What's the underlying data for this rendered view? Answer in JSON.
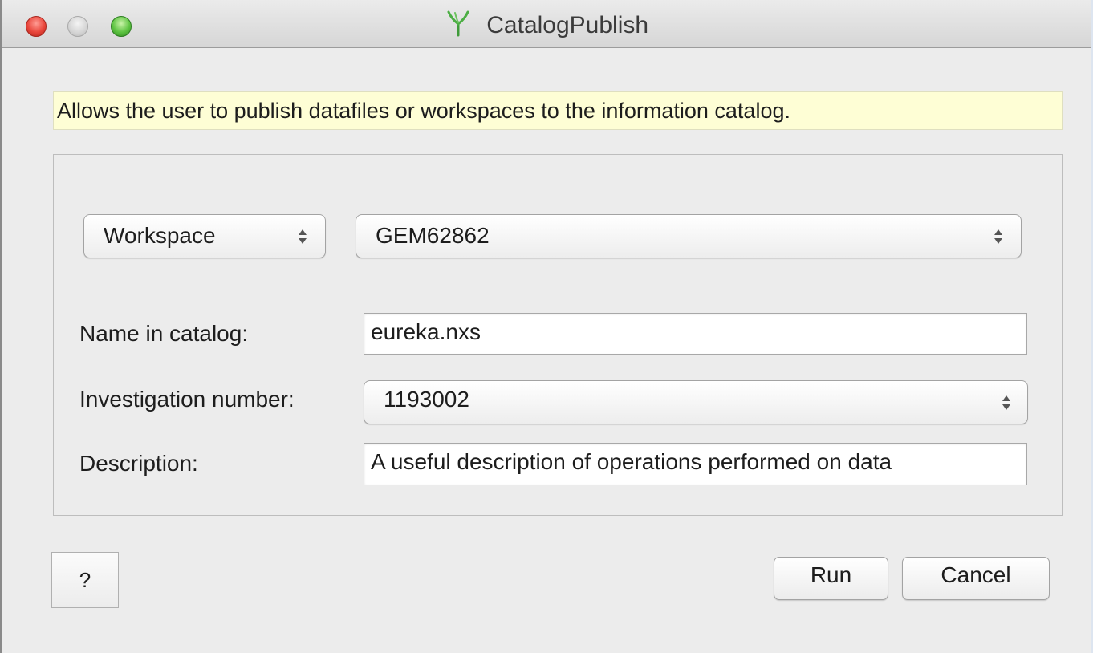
{
  "window": {
    "title": "CatalogPublish",
    "app_icon": "mantid-icon"
  },
  "description_banner": "Allows the user to publish datafiles or workspaces to the information catalog.",
  "source": {
    "type_selected": "Workspace",
    "item_selected": "GEM62862"
  },
  "form": {
    "name_label": "Name in catalog:",
    "name_value": "eureka.nxs",
    "investigation_label": "Investigation number:",
    "investigation_value": "1193002",
    "description_label": "Description:",
    "description_value": "A useful description of operations performed on data"
  },
  "buttons": {
    "help": "?",
    "run": "Run",
    "cancel": "Cancel"
  },
  "colors": {
    "banner_background": "#fefed5",
    "close_button": "#e9463b",
    "zoom_button": "#5dc341",
    "window_background": "#ececec"
  }
}
